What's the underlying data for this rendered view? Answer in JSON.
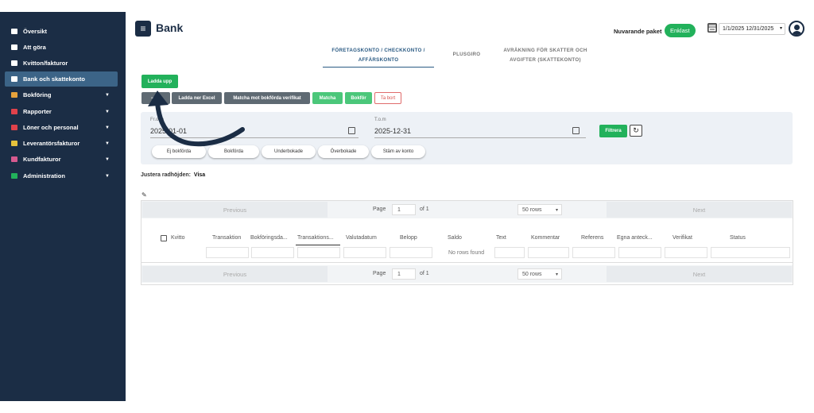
{
  "sidebar": {
    "items": [
      {
        "label": "Översikt",
        "color": "#ffffff",
        "caret": false,
        "active": false
      },
      {
        "label": "Att göra",
        "color": "#ffffff",
        "caret": false,
        "active": false
      },
      {
        "label": "Kvitton/fakturor",
        "color": "#ffffff",
        "caret": false,
        "active": false
      },
      {
        "label": "Bank och skattekonto",
        "color": "#ffffff",
        "caret": false,
        "active": true
      },
      {
        "label": "Bokföring",
        "color": "#e6a23c",
        "caret": true,
        "active": false
      },
      {
        "label": "Rapporter",
        "color": "#e0424b",
        "caret": true,
        "active": false
      },
      {
        "label": "Löner och personal",
        "color": "#e0424b",
        "caret": true,
        "active": false
      },
      {
        "label": "Leverantörsfakturor",
        "color": "#e6c23c",
        "caret": true,
        "active": false
      },
      {
        "label": "Kundfakturor",
        "color": "#d65a8f",
        "caret": true,
        "active": false
      },
      {
        "label": "Administration",
        "color": "#22b15b",
        "caret": true,
        "active": false
      }
    ]
  },
  "header": {
    "title": "Bank",
    "paket_label": "Nuvarande paket",
    "paket_value": "Enklast",
    "date_range": "1/1/2025 12/31/2025"
  },
  "tabs": [
    {
      "label": "FÖRETAGSKONTO / CHECKKONTO / AFFÄRSKONTO",
      "active": true
    },
    {
      "label": "PLUSGIRO",
      "active": false
    },
    {
      "label": "AVRÄKNING FÖR SKATTER OCH AVGIFTER (SKATTEKONTO)",
      "active": false
    }
  ],
  "toolbar": {
    "upload": "Ladda upp",
    "minus": "−",
    "minus_label": "Ex",
    "excel": "Ladda ner Excel",
    "match_verif": "Matcha mot bokförda verifikat",
    "match": "Matcha",
    "bokfor": "Bokför",
    "ta_bort": "Ta bort"
  },
  "filter": {
    "from_label": "Fr.o.m",
    "from_value": "2025-01-01",
    "to_label": "T.o.m",
    "to_value": "2025-12-31",
    "apply": "Filtrera",
    "refresh_icon": "↻",
    "pills": [
      "Ej bokförda",
      "Bokförda",
      "Underbokade",
      "Överbokade",
      "Stäm av konto"
    ]
  },
  "justera": {
    "label": "Justera radhöjden:",
    "value": "Visa"
  },
  "grid": {
    "prev": "Previous",
    "next": "Next",
    "page_label": "Page",
    "page": "1",
    "of": "of 1",
    "rows": "50 rows",
    "columns": [
      "Kvitto",
      "Transaktion",
      "Bokföringsda...",
      "Transaktions...",
      "Valutadatum",
      "Belopp",
      "Saldo",
      "Text",
      "Kommentar",
      "Referens",
      "Egna anteck...",
      "Verifikat",
      "Status"
    ],
    "empty": "No rows found"
  }
}
